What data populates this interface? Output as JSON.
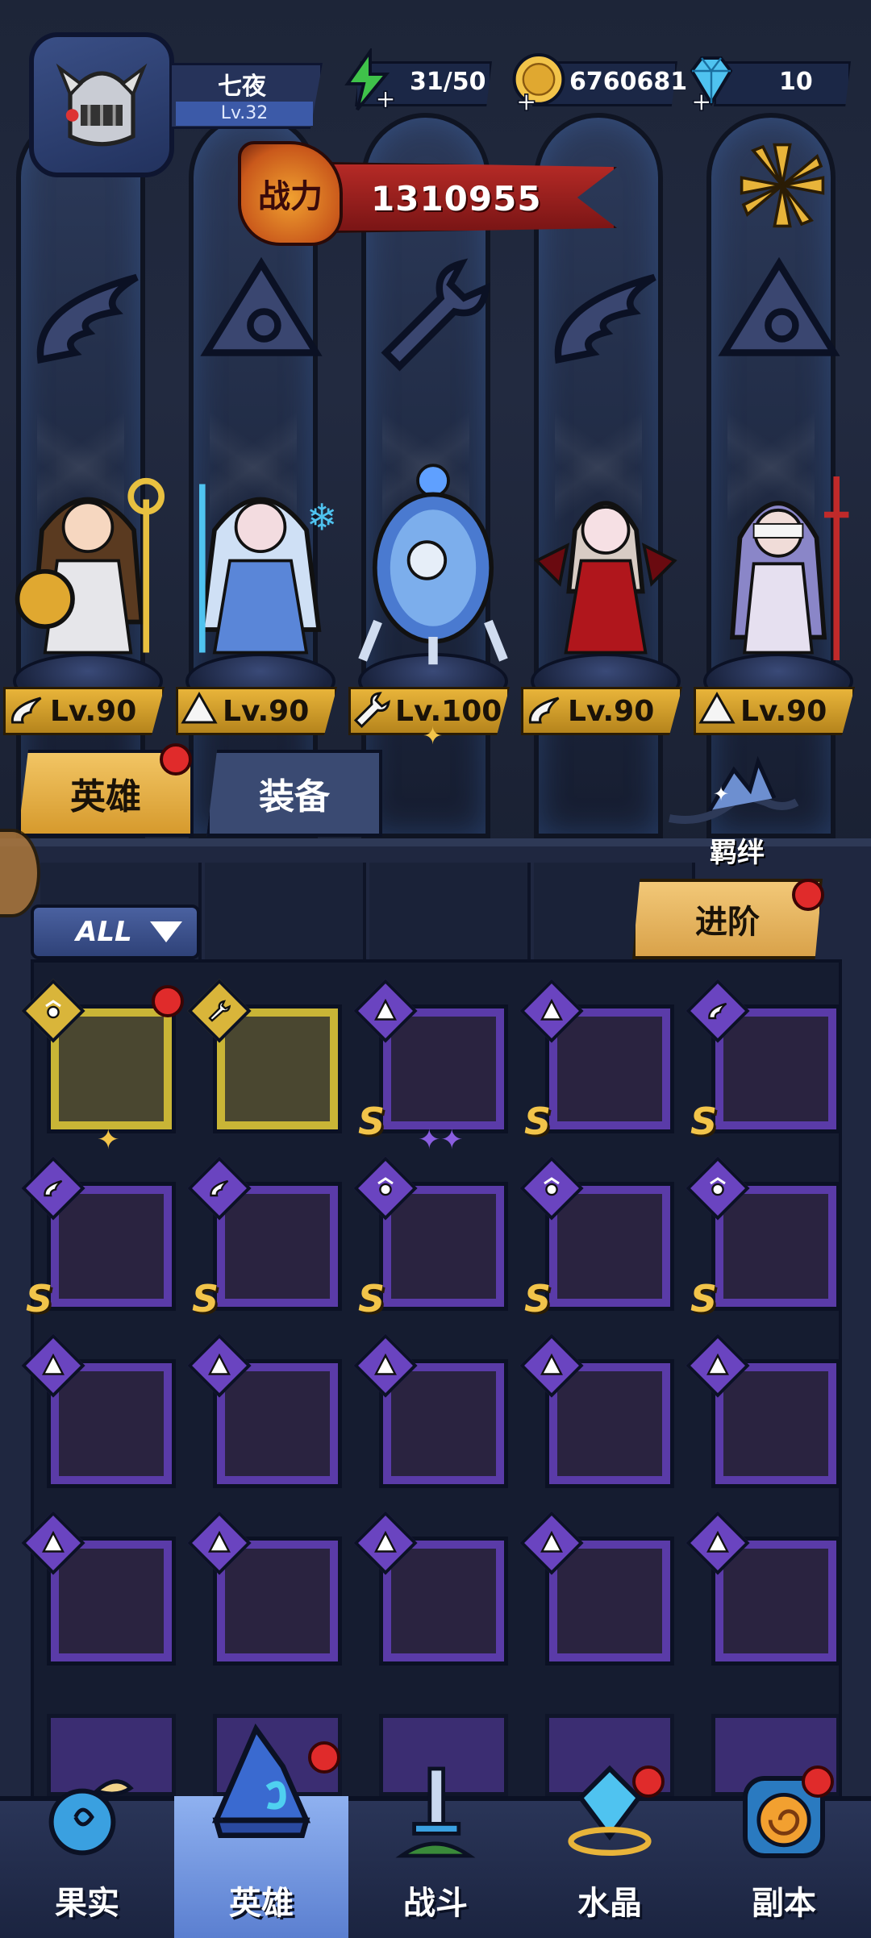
{
  "player": {
    "name": "七夜",
    "level": "Lv.32",
    "avatar_icon": "knight-helmet-icon"
  },
  "resources": {
    "energy": {
      "value": "31/50",
      "icon": "energy-bolt-icon",
      "color": "#3fc24a"
    },
    "gold": {
      "value": "6760681",
      "icon": "gold-coin-icon",
      "color": "#f2c44a"
    },
    "gems": {
      "value": "10",
      "icon": "diamond-icon",
      "color": "#4fc3f0"
    }
  },
  "power": {
    "label": "战力",
    "value": "1310955"
  },
  "emblems": [
    "wing-class-icon",
    "hat-class-icon",
    "wrench-class-icon",
    "wing-class-icon",
    "hat-class-icon"
  ],
  "team": [
    {
      "level": "Lv.90",
      "class_icon": "wing-icon",
      "hero": "golden-goddess"
    },
    {
      "level": "Lv.90",
      "class_icon": "mage-hat-icon",
      "hero": "ice-sorceress"
    },
    {
      "level": "Lv.100",
      "class_icon": "wrench-icon",
      "hero": "glass-capsule-mech"
    },
    {
      "level": "Lv.90",
      "class_icon": "wing-icon",
      "hero": "vampire-lady"
    },
    {
      "level": "Lv.90",
      "class_icon": "mage-hat-icon",
      "hero": "blindfolded-nun"
    }
  ],
  "tabs": {
    "heroes": "英雄",
    "equipment": "装备"
  },
  "bond": {
    "label": "羁绊"
  },
  "filter": {
    "label": "ALL"
  },
  "advance": {
    "label": "进阶"
  },
  "grid": [
    [
      {
        "frame": "gold",
        "class": "flower",
        "s": false,
        "stars": 1,
        "star_color": "gold",
        "dot": true
      },
      {
        "frame": "gold",
        "class": "wrench",
        "s": false,
        "stars": 0,
        "dot": false
      },
      {
        "frame": "purple",
        "class": "hat",
        "s": true,
        "stars": 2,
        "star_color": "purple",
        "dot": false
      },
      {
        "frame": "purple",
        "class": "hat",
        "s": true,
        "stars": 0,
        "dot": false
      },
      {
        "frame": "purple",
        "class": "wing",
        "s": true,
        "stars": 0,
        "dot": false
      }
    ],
    [
      {
        "frame": "purple",
        "class": "wing",
        "s": true,
        "stars": 0,
        "dot": false
      },
      {
        "frame": "purple",
        "class": "wing",
        "s": true,
        "stars": 0,
        "dot": false
      },
      {
        "frame": "purple",
        "class": "flower",
        "s": true,
        "stars": 0,
        "dot": false
      },
      {
        "frame": "purple",
        "class": "flower",
        "s": true,
        "stars": 0,
        "dot": false
      },
      {
        "frame": "purple",
        "class": "flower",
        "s": true,
        "stars": 0,
        "dot": false
      }
    ],
    [
      {
        "frame": "purple",
        "class": "hat",
        "s": false,
        "stars": 0,
        "dot": false
      },
      {
        "frame": "purple",
        "class": "hat",
        "s": false,
        "stars": 0,
        "dot": false
      },
      {
        "frame": "purple",
        "class": "hat",
        "s": false,
        "stars": 0,
        "dot": false
      },
      {
        "frame": "purple",
        "class": "hat",
        "s": false,
        "stars": 0,
        "dot": false
      },
      {
        "frame": "purple",
        "class": "hat",
        "s": false,
        "stars": 0,
        "dot": false
      }
    ],
    [
      {
        "frame": "purple",
        "class": "hat",
        "s": false,
        "stars": 0,
        "dot": false
      },
      {
        "frame": "purple",
        "class": "hat",
        "s": false,
        "stars": 0,
        "dot": false
      },
      {
        "frame": "purple",
        "class": "hat",
        "s": false,
        "stars": 0,
        "dot": false
      },
      {
        "frame": "purple",
        "class": "hat",
        "s": false,
        "stars": 0,
        "dot": false
      },
      {
        "frame": "purple",
        "class": "hat",
        "s": false,
        "stars": 0,
        "dot": false
      }
    ]
  ],
  "nav": [
    {
      "label": "果实",
      "icon": "fruit-icon",
      "active": false,
      "dot": false
    },
    {
      "label": "英雄",
      "icon": "hero-hat-icon",
      "active": true,
      "dot": true
    },
    {
      "label": "战斗",
      "icon": "sword-icon",
      "active": false,
      "dot": false
    },
    {
      "label": "水晶",
      "icon": "crystal-icon",
      "active": false,
      "dot": true
    },
    {
      "label": "副本",
      "icon": "portal-icon",
      "active": false,
      "dot": true
    }
  ]
}
